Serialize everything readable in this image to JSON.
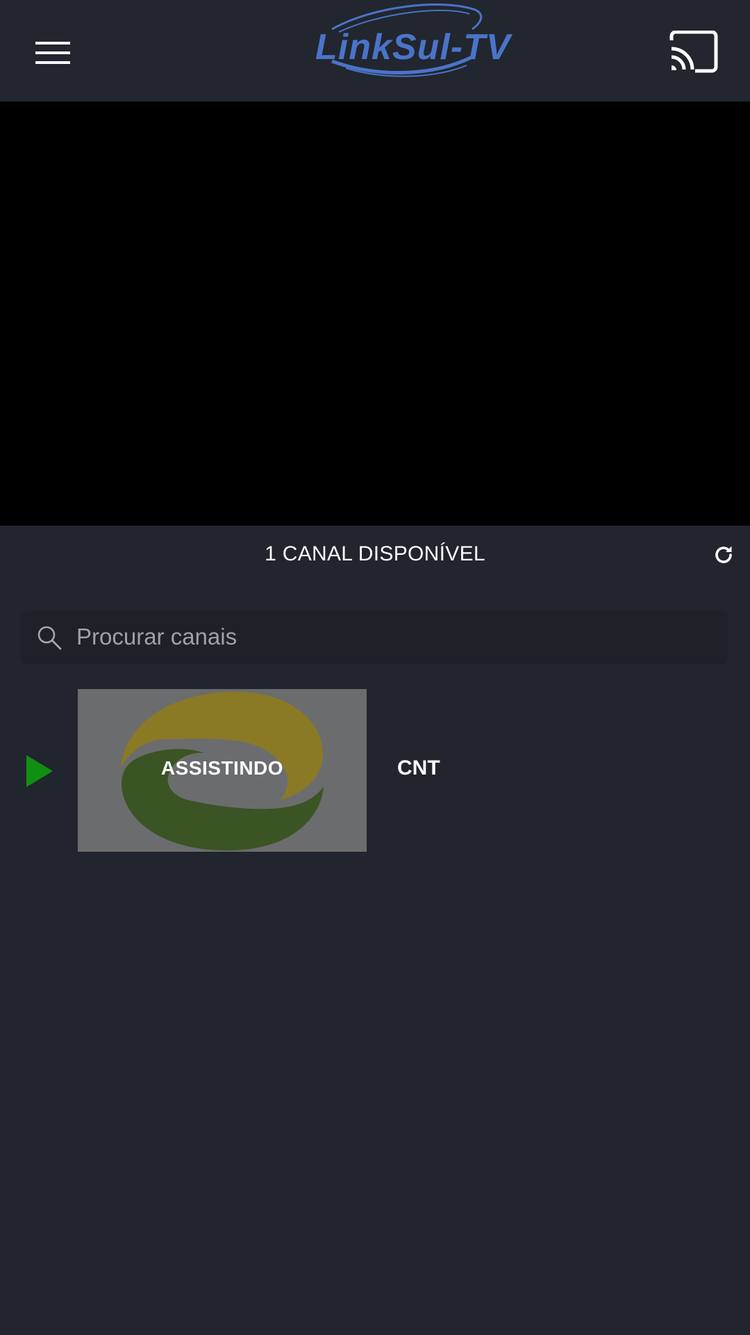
{
  "app_bar": {
    "logo_text": "LinkSul-TV",
    "menu_icon": "hamburger-menu-icon",
    "cast_icon": "cast-icon"
  },
  "channels_header": {
    "count_label": "1 CANAL DISPONÍVEL",
    "refresh_icon": "refresh-icon"
  },
  "search": {
    "placeholder": "Procurar canais",
    "value": "",
    "icon": "search-icon"
  },
  "channels": [
    {
      "name": "CNT",
      "status_label": "ASSISTINDO",
      "playing": true
    }
  ],
  "colors": {
    "background": "#21252d",
    "app_bar": "#22262e",
    "logo_blue": "#4a74c9",
    "playing_green": "#109010",
    "thumbnail_bg": "#6b6c6e",
    "logo_yellow": "#8a7a26",
    "logo_green": "#3b5424"
  }
}
